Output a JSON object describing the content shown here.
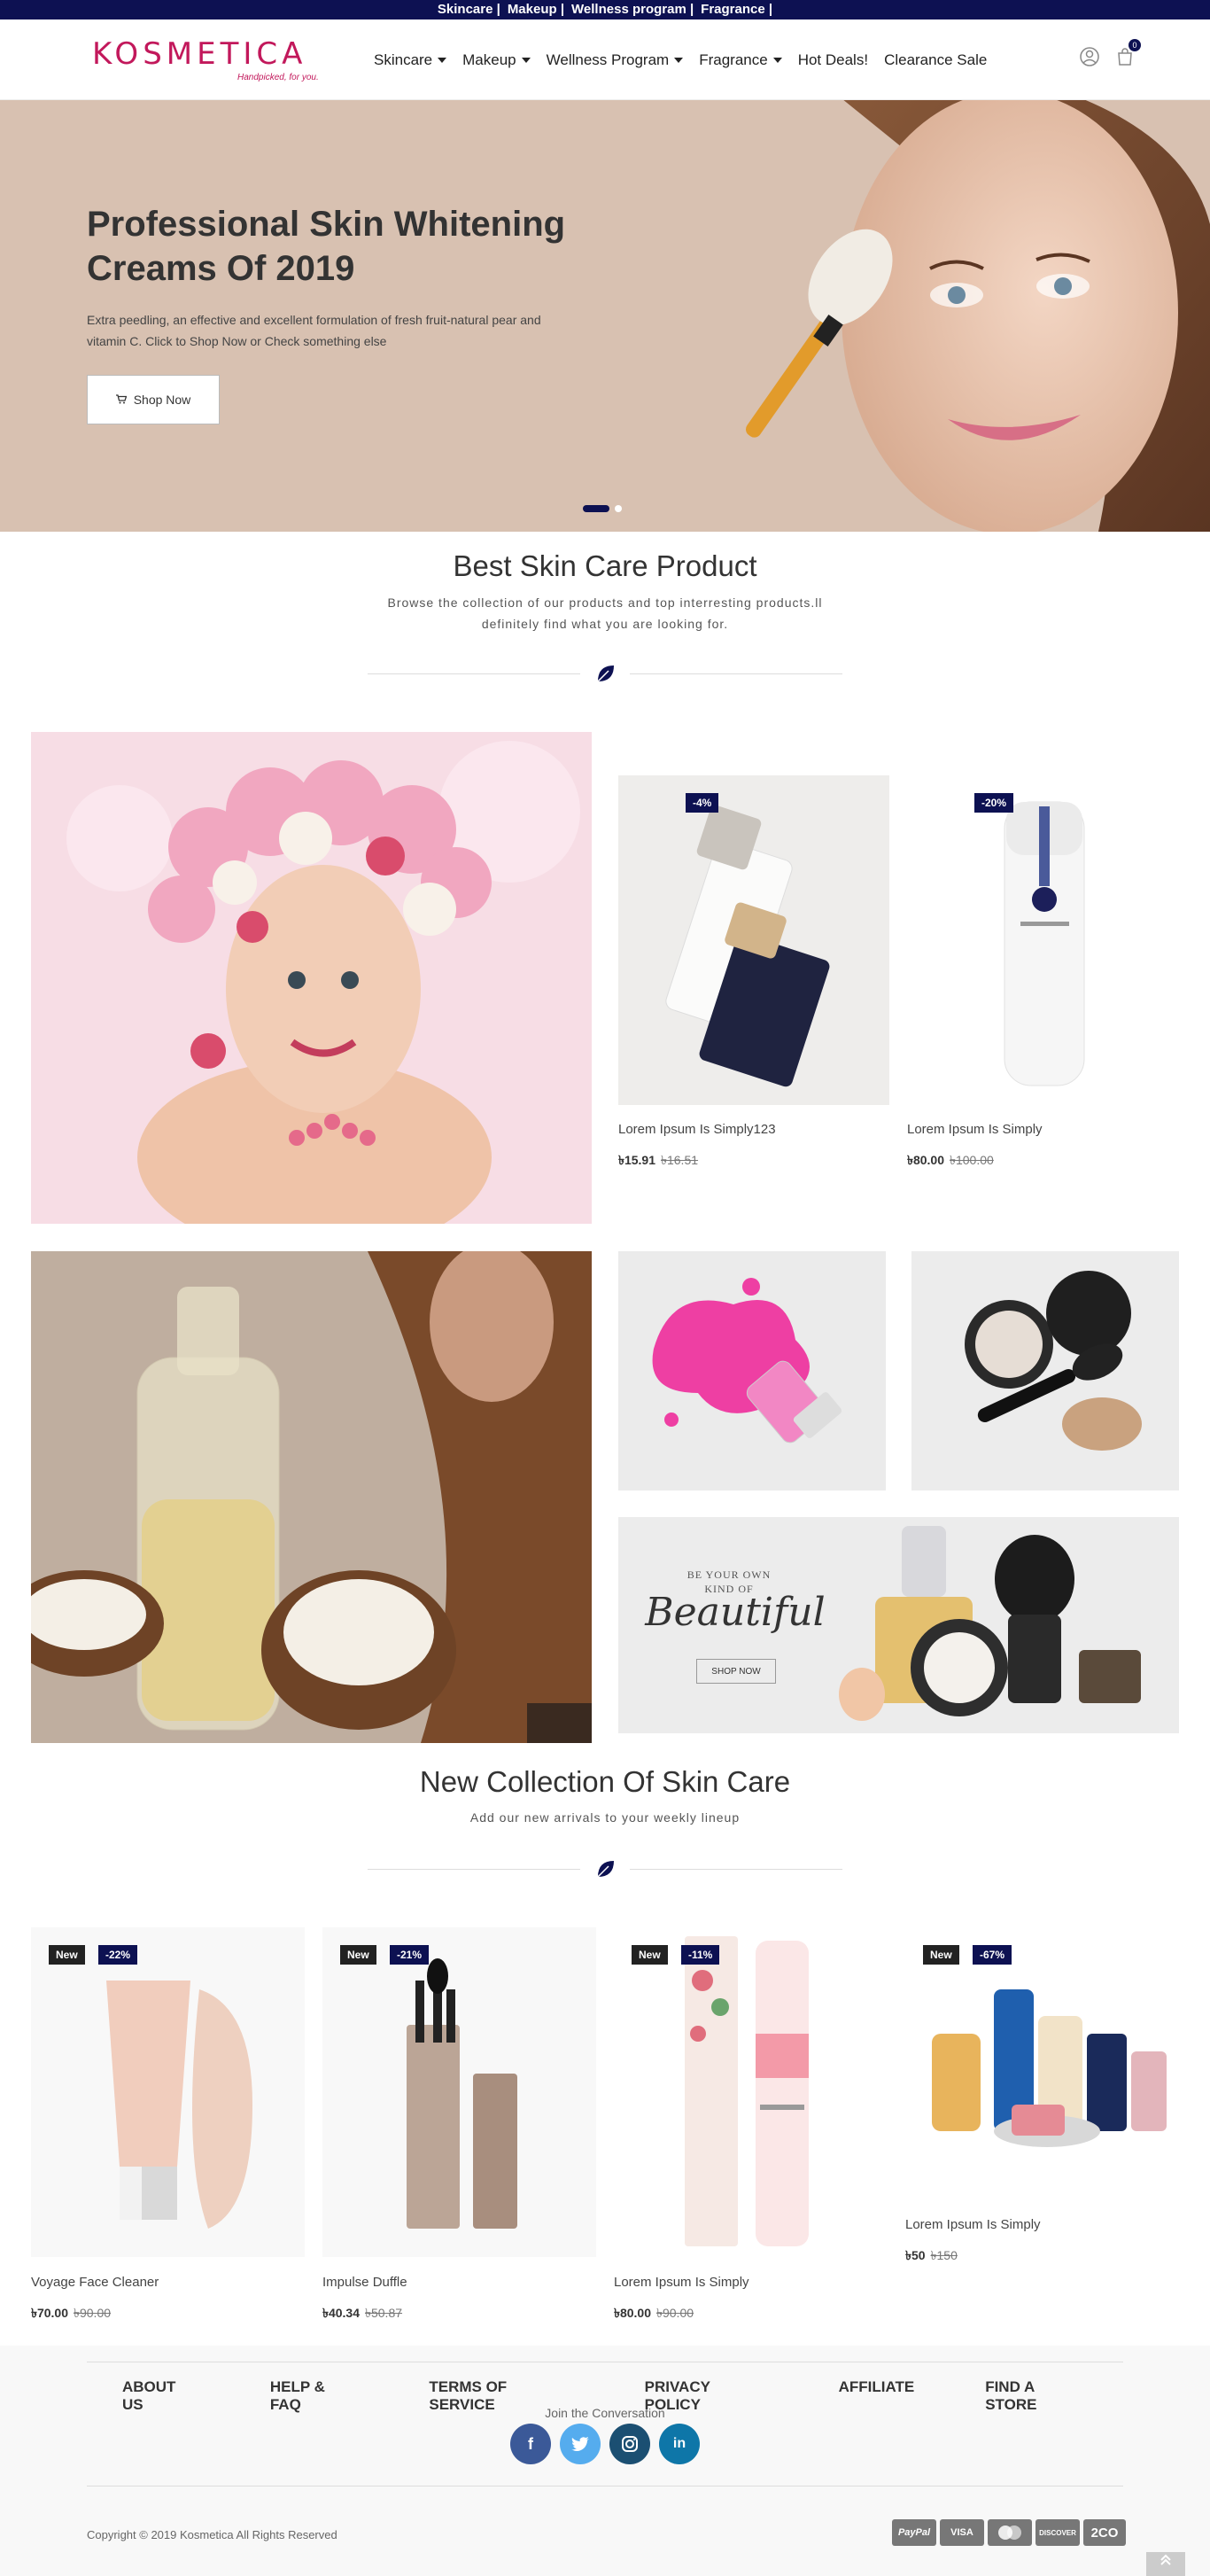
{
  "topbar": {
    "links": [
      "Skincare |",
      "Makeup |",
      "Wellness program |",
      "Fragrance |"
    ]
  },
  "header": {
    "logo": "KOSMETICA",
    "tagline": "Handpicked, for you.",
    "nav": [
      "Skincare",
      "Makeup",
      "Wellness Program",
      "Fragrance",
      "Hot Deals!",
      "Clearance Sale"
    ],
    "cart_count": "0"
  },
  "hero": {
    "title": "Professional Skin Whitening Creams Of 2019",
    "description": "Extra peedling, an effective and excellent formulation of fresh fruit-natural pear and vitamin C. Click to Shop Now or Check something else",
    "button": "Shop Now"
  },
  "best": {
    "title": "Best Skin Care Product",
    "description": "Browse the collection of our products and top interresting products.ll definitely find what you are looking for."
  },
  "featured": [
    {
      "badge": "-4%",
      "name": "Lorem Ipsum Is Simply123",
      "price": "৳15.91",
      "old_price": "৳16.51"
    },
    {
      "badge": "-20%",
      "name": "Lorem Ipsum Is Simply",
      "price": "৳80.00",
      "old_price": "৳100.00"
    }
  ],
  "promo": {
    "line1": "BE YOUR OWN",
    "line2": "KIND OF",
    "line3": "Beautiful",
    "button": "SHOP NOW"
  },
  "new_collection": {
    "title": "New Collection Of Skin Care",
    "description": "Add our new arrivals to your weekly lineup",
    "new_label": "New",
    "products": [
      {
        "badge": "-22%",
        "name": "Voyage Face Cleaner",
        "price": "৳70.00",
        "old_price": "৳90.00"
      },
      {
        "badge": "-21%",
        "name": "Impulse Duffle",
        "price": "৳40.34",
        "old_price": "৳50.87"
      },
      {
        "badge": "-11%",
        "name": "Lorem Ipsum Is Simply",
        "price": "৳80.00",
        "old_price": "৳90.00"
      },
      {
        "badge": "-67%",
        "name": "Lorem Ipsum Is Simply",
        "price": "৳50",
        "old_price": "৳150"
      }
    ]
  },
  "footer": {
    "links": [
      "ABOUT US",
      "HELP & FAQ",
      "TERMS OF SERVICE",
      "PRIVACY POLICY",
      "AFFILIATE",
      "FIND A STORE"
    ],
    "join": "Join the Conversation",
    "socials": [
      "f",
      "t",
      "ig",
      "in"
    ],
    "copyright": "Copyright © 2019 Kosmetica All Rights Reserved",
    "payments": [
      "PayPal",
      "VISA",
      "MC",
      "DISCOVER",
      "2CO"
    ]
  },
  "colors": {
    "navy": "#0d1152",
    "brand": "#c2185b",
    "hero_bg": "#d8c1b1"
  }
}
